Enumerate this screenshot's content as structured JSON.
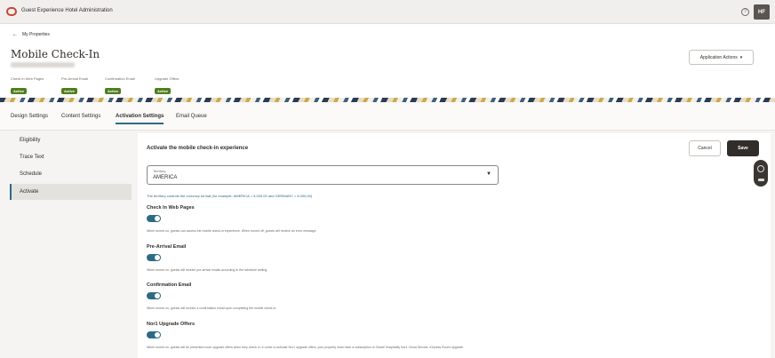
{
  "app": {
    "title": "Guest Experience Hotel Administration",
    "help_glyph": "?",
    "user_initials": "HF"
  },
  "header": {
    "back_label": "My Properties",
    "page_title": "Mobile Check-In",
    "application_actions": "Application Actions",
    "statuses": [
      {
        "label": "Check in Web Pages",
        "value": "Active"
      },
      {
        "label": "Pre-Arrival Email",
        "value": "Active"
      },
      {
        "label": "Confirmation Email",
        "value": "Active"
      },
      {
        "label": "Upgrade Offers",
        "value": "Active"
      }
    ]
  },
  "tabs": [
    {
      "label": "Design Settings",
      "active": false
    },
    {
      "label": "Content Settings",
      "active": false
    },
    {
      "label": "Activation Settings",
      "active": true
    },
    {
      "label": "Email Queue",
      "active": false
    }
  ],
  "leftnav": {
    "items": [
      {
        "label": "Eligibility",
        "active": false
      },
      {
        "label": "Trace Text",
        "active": false
      },
      {
        "label": "Schedule",
        "active": false
      },
      {
        "label": "Activate",
        "active": true
      }
    ]
  },
  "main": {
    "section_title": "Activate the mobile check-in experience",
    "cancel_label": "Cancel",
    "save_label": "Save",
    "territory": {
      "label": "Territory",
      "value": "AMERICA"
    },
    "territory_help": "The territory controls the currency format (for example: AMERICA = 5,000.00 and GERMANY = 5.000,00)",
    "settings": [
      {
        "label": "Check In Web Pages",
        "enabled": true,
        "help": "When turned on, guests can access the mobile check-in experience. When turned off, guests will receive an error message."
      },
      {
        "label": "Pre-Arrival Email",
        "enabled": true,
        "help": "When turned on, guests will receive pre-arrival emails according to the schedule setting."
      },
      {
        "label": "Confirmation Email",
        "enabled": true,
        "help": "When turned on, guests will receive a confirmation email upon completing the mobile check-in."
      },
      {
        "label": "Nor1 Upgrade Offers",
        "enabled": true,
        "help": "When turned on, guests will be presented room upgrade offers when they check in. In order to activate Nor1 upgrade offers, your property must have a subscription to Oracle Hospitality Nor1 Cloud Service, eXpress Room Upgrade."
      }
    ]
  }
}
